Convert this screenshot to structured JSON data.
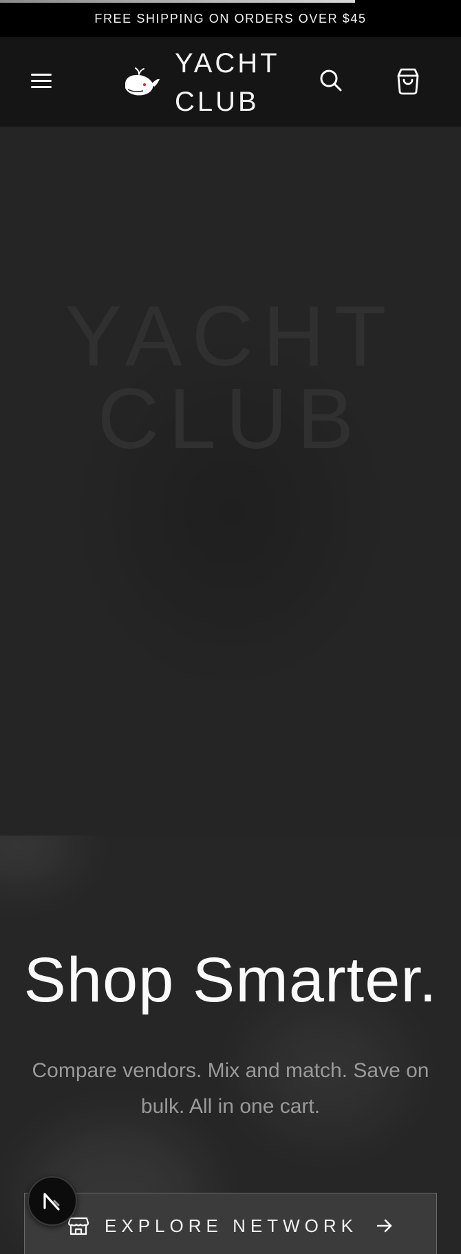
{
  "loading": {
    "progress": 0.77
  },
  "announcement": {
    "text": "FREE SHIPPING ON ORDERS OVER $45"
  },
  "header": {
    "brand_line1": "YACHT",
    "brand_line2": "CLUB",
    "icons": {
      "menu": "hamburger-menu-icon",
      "logo": "whale-logo-icon",
      "search": "search-icon",
      "cart": "shopping-bag-icon"
    }
  },
  "hero": {
    "watermark_line1": "YACHT",
    "watermark_line2": "CLUB"
  },
  "promo": {
    "title": "Shop Smarter.",
    "subtitle": "Compare vendors. Mix and match. Save on bulk. All in one cart.",
    "button_label": "EXPLORE NETWORK",
    "button_icons": {
      "leading": "storefront-icon",
      "trailing": "arrow-right-icon"
    }
  },
  "floating_button": {
    "icon": "n-logo-icon"
  },
  "colors": {
    "announcement_bg": "#000000",
    "header_bg": "#151515",
    "hero_bg": "#232323",
    "accent_red": "#d2262f"
  }
}
